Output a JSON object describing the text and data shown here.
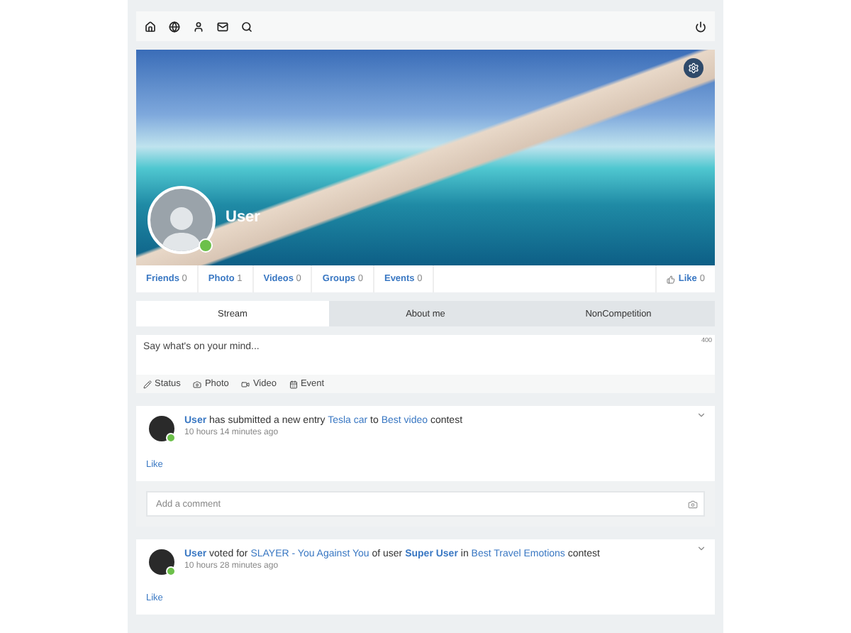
{
  "profile": {
    "name": "User",
    "online": true
  },
  "stats": [
    {
      "label": "Friends",
      "count": "0"
    },
    {
      "label": "Photo",
      "count": "1"
    },
    {
      "label": "Videos",
      "count": "0"
    },
    {
      "label": "Groups",
      "count": "0"
    },
    {
      "label": "Events",
      "count": "0"
    }
  ],
  "like": {
    "label": "Like",
    "count": "0"
  },
  "tabs": [
    {
      "label": "Stream",
      "selected": true
    },
    {
      "label": "About me",
      "selected": false
    },
    {
      "label": "NonCompetition",
      "selected": false
    }
  ],
  "composer": {
    "placeholder": "Say what's on your mind...",
    "counter": "400",
    "actions": [
      {
        "kind": "status",
        "label": "Status"
      },
      {
        "kind": "photo",
        "label": "Photo"
      },
      {
        "kind": "video",
        "label": "Video"
      },
      {
        "kind": "event",
        "label": "Event"
      }
    ]
  },
  "feed": [
    {
      "parts": [
        {
          "kind": "user",
          "text": "User"
        },
        {
          "kind": "text",
          "text": " has submitted a new entry "
        },
        {
          "kind": "link",
          "text": "Tesla car"
        },
        {
          "kind": "text",
          "text": " to "
        },
        {
          "kind": "link",
          "text": "Best video"
        },
        {
          "kind": "text",
          "text": " contest"
        }
      ],
      "time": "10 hours 14 minutes ago",
      "online": true,
      "like": "Like",
      "comment_placeholder": "Add a comment"
    },
    {
      "parts": [
        {
          "kind": "user",
          "text": "User"
        },
        {
          "kind": "text",
          "text": " voted for "
        },
        {
          "kind": "link",
          "text": "SLAYER - You Against You"
        },
        {
          "kind": "text",
          "text": " of user "
        },
        {
          "kind": "user",
          "text": "Super User"
        },
        {
          "kind": "text",
          "text": " in "
        },
        {
          "kind": "link",
          "text": "Best Travel Emotions"
        },
        {
          "kind": "text",
          "text": " contest"
        }
      ],
      "time": "10 hours 28 minutes ago",
      "online": true,
      "like": "Like"
    }
  ]
}
